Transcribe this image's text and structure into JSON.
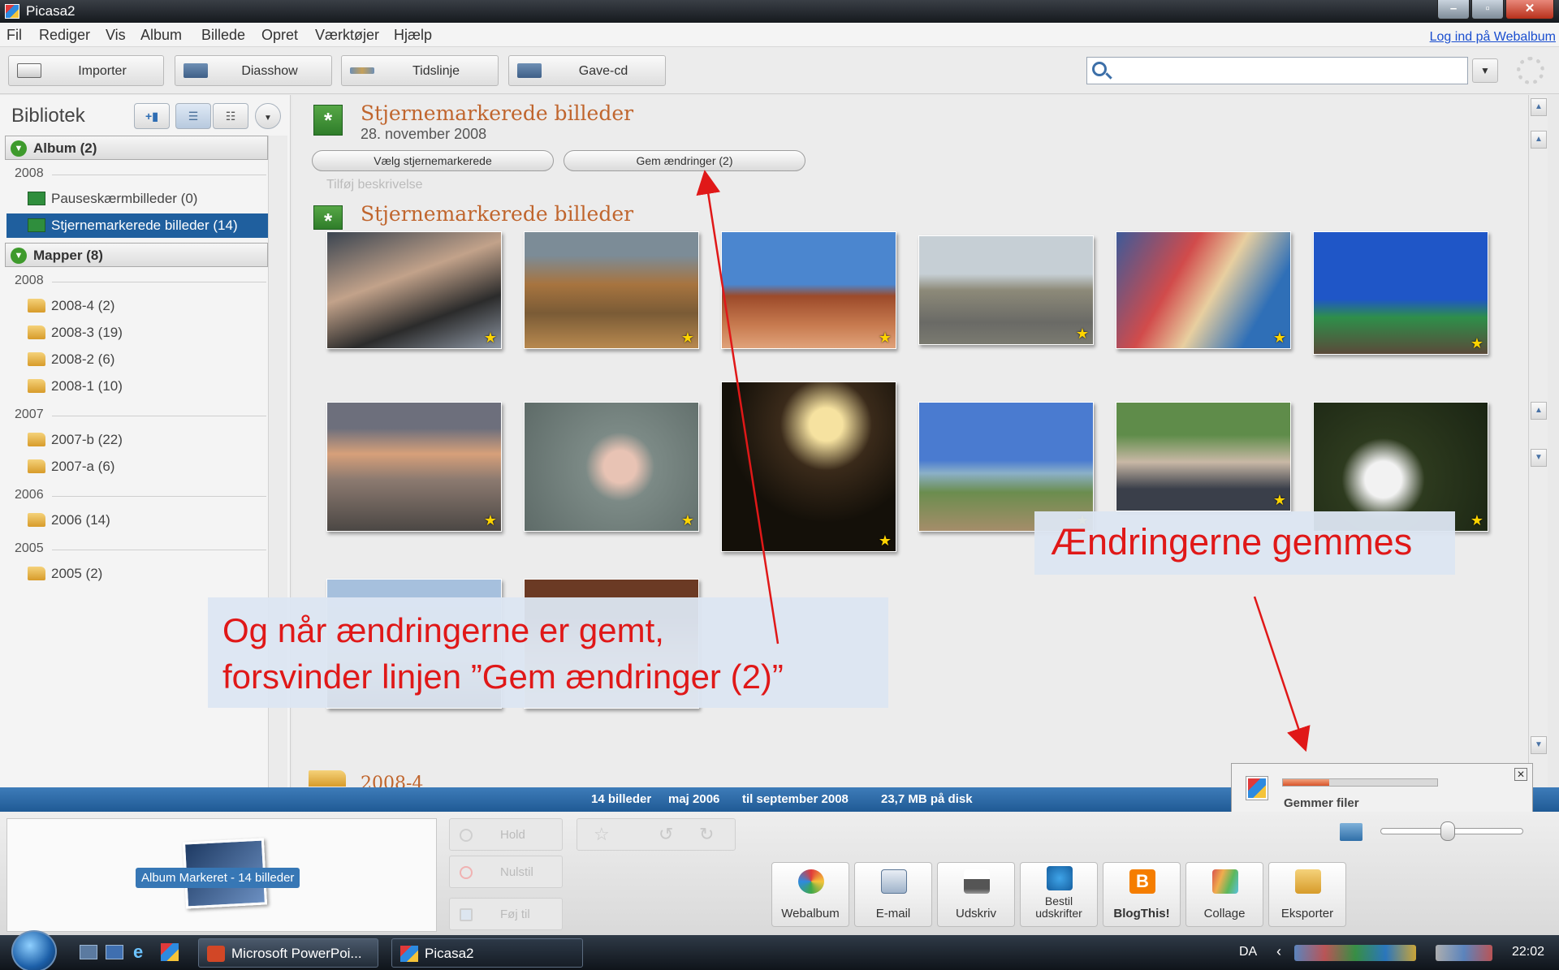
{
  "window": {
    "title": "Picasa2"
  },
  "menu": {
    "items": [
      "Fil",
      "Rediger",
      "Vis",
      "Album",
      "Billede",
      "Opret",
      "Værktøjer",
      "Hjælp"
    ],
    "login_link": "Log ind på Webalbum"
  },
  "toolbar": {
    "buttons": [
      {
        "label": "Importer",
        "icon": "import-icon"
      },
      {
        "label": "Diasshow",
        "icon": "slideshow-icon"
      },
      {
        "label": "Tidslinje",
        "icon": "timeline-icon"
      },
      {
        "label": "Gave-cd",
        "icon": "gift-cd-icon"
      }
    ],
    "search": {
      "value": "",
      "placeholder": ""
    }
  },
  "sidebar": {
    "title": "Bibliotek",
    "album_section": "Album (2)",
    "album_year": "2008",
    "albums": [
      "Pauseskærmbilleder (0)",
      "Stjernemarkerede billeder (14)"
    ],
    "folder_section": "Mapper (8)",
    "folder_groups": [
      {
        "year": "2008",
        "items": [
          "2008-4 (2)",
          "2008-3 (19)",
          "2008-2 (6)",
          "2008-1 (10)"
        ]
      },
      {
        "year": "2007",
        "items": [
          "2007-b (22)",
          "2007-a (6)"
        ]
      },
      {
        "year": "2006",
        "items": [
          "2006 (14)"
        ]
      },
      {
        "year": "2005",
        "items": [
          "2005 (2)"
        ]
      }
    ]
  },
  "main": {
    "album_title": "Stjernemarkerede billeder",
    "album_date": "28. november 2008",
    "select_starred_button": "Vælg stjernemarkerede",
    "save_changes_button": "Gem ændringer (2)",
    "add_description_placeholder": "Tilføj beskrivelse",
    "album_title_2": "Stjernemarkerede billeder",
    "next_folder": "2008-4"
  },
  "statusbar": {
    "count": "14 billeder",
    "from": "maj 2006",
    "to": "til september 2008",
    "size": "23,7 MB på disk"
  },
  "save_popup": {
    "label": "Gemmer filer",
    "progress": 0.3
  },
  "tray": {
    "selection_label": "Album Markeret - 14 billeder",
    "hold_button": "Hold",
    "reset_button": "Nulstil",
    "add_to_button": "Føj til",
    "tools": [
      {
        "label": "Webalbum",
        "icon": "webalbum-icon"
      },
      {
        "label": "E-mail",
        "icon": "email-icon"
      },
      {
        "label": "Udskriv",
        "icon": "print-icon"
      },
      {
        "label": "Bestil udskrifter",
        "icon": "order-prints-icon"
      },
      {
        "label": "BlogThis!",
        "icon": "blogger-icon"
      },
      {
        "label": "Collage",
        "icon": "collage-icon"
      },
      {
        "label": "Eksporter",
        "icon": "export-icon"
      }
    ]
  },
  "taskbar": {
    "tasks": [
      "Microsoft PowerPoi...",
      "Picasa2"
    ],
    "language": "DA",
    "clock": "22:02"
  },
  "annotations": {
    "left_line1": "Og når ændringerne er gemt,",
    "left_line2": "forsvinder linjen ”Gem ændringer (2)”",
    "right": "Ændringerne gemmes"
  },
  "colors": {
    "accent": "#1f5f9e",
    "annotation_red": "#e01818",
    "album_title": "#c0652d"
  }
}
